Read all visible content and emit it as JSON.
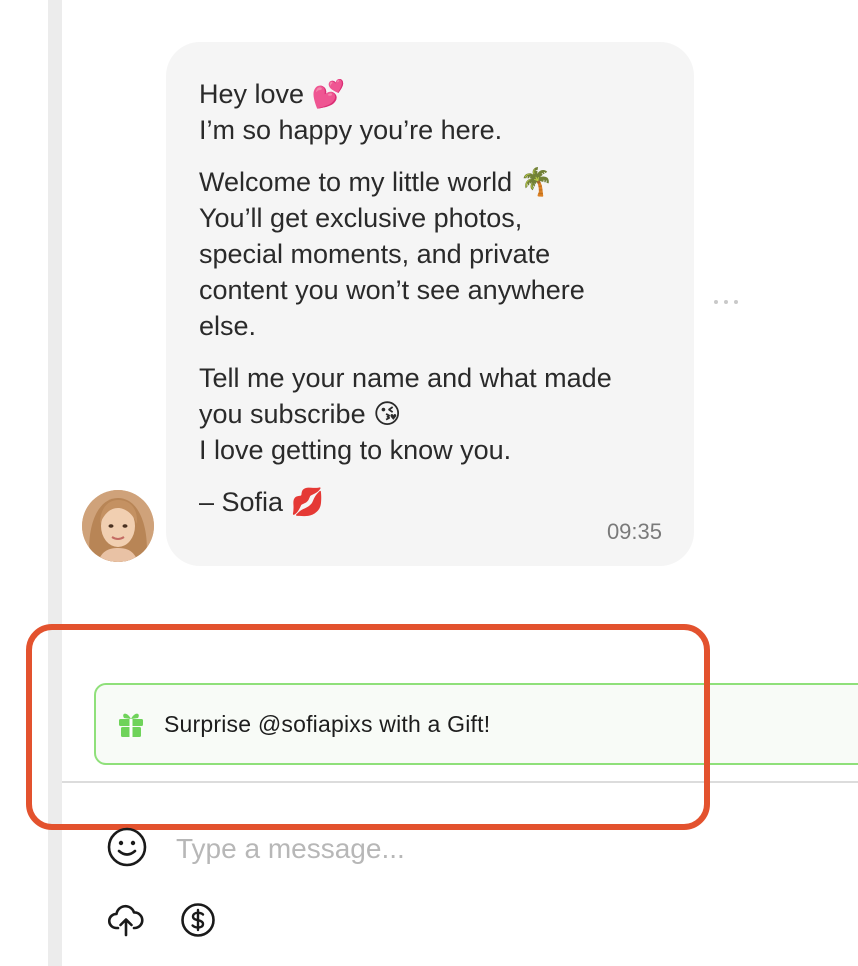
{
  "message": {
    "lines_p1": [
      "Hey love 💕",
      "I’m so happy you’re here."
    ],
    "lines_p2": [
      "Welcome to my little world 🌴",
      "You’ll get exclusive photos,",
      "special moments, and private",
      "content you won’t see anywhere",
      "else."
    ],
    "lines_p3": [
      "Tell me your name and what made",
      "you subscribe 😘",
      "I love getting to know you."
    ],
    "signature": "– Sofia 💋",
    "time": "09:35"
  },
  "gift_banner": {
    "label": "Surprise @sofiapixs with a Gift!",
    "icon": "gift-icon",
    "accent_color": "#8fe07a"
  },
  "composer": {
    "placeholder": "Type a message...",
    "icons": [
      "smile-icon",
      "upload-icon",
      "dollar-icon"
    ]
  },
  "highlight_color": "#e3522e"
}
